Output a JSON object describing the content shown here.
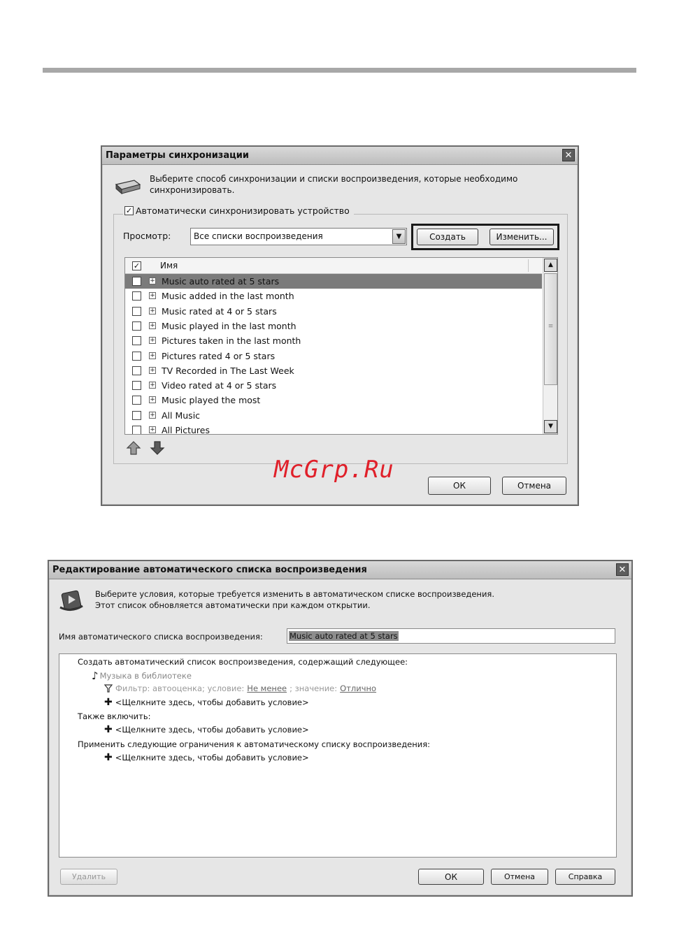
{
  "sync_dialog": {
    "title": "Параметры синхронизации",
    "description": "Выберите способ синхронизации и списки воспроизведения, которые необходимо синхронизировать.",
    "auto_sync_label": "Автоматически синхронизировать устройство",
    "auto_sync_checked": true,
    "view_label": "Просмотр:",
    "view_value": "Все списки воспроизведения",
    "create_button": "Создать",
    "edit_button": "Изменить...",
    "column_name": "Имя",
    "playlists": [
      {
        "label": "Music auto rated at 5 stars",
        "selected": true
      },
      {
        "label": "Music added in the last month"
      },
      {
        "label": "Music rated at 4 or 5 stars"
      },
      {
        "label": "Music played in the last month"
      },
      {
        "label": "Pictures taken in the last month"
      },
      {
        "label": "Pictures rated 4 or 5 stars"
      },
      {
        "label": "TV Recorded in The Last Week"
      },
      {
        "label": "Video rated at 4 or 5 stars"
      },
      {
        "label": "Music played the most"
      },
      {
        "label": "All Music"
      },
      {
        "label": "All Pictures"
      }
    ],
    "ok_button": "ОК",
    "cancel_button": "Отмена"
  },
  "watermark": "McGrp.Ru",
  "edit_dialog": {
    "title": "Редактирование автоматического списка воспроизведения",
    "description_line1": "Выберите условия, которые требуется изменить в автоматическом списке воспроизведения.",
    "description_line2": "Этот список обновляется автоматически при каждом открытии.",
    "name_label": "Имя автоматического списка воспроизведения:",
    "name_value": "Music auto rated at 5 stars",
    "rules": {
      "create_heading": "Создать автоматический список воспроизведения, содержащий следующее:",
      "library_item": "Музыка в библиотеке",
      "filter_prefix": "Фильтр: автооценка; условие:",
      "filter_condition": "Не менее",
      "filter_mid": "; значение:",
      "filter_value": "Отлично",
      "add_condition_1": "<Щелкните здесь, чтобы добавить условие>",
      "also_include": "Также включить:",
      "add_condition_2": "<Щелкните здесь, чтобы добавить условие>",
      "apply_limits": "Применить следующие ограничения к автоматическому списку воспроизведения:",
      "add_condition_3": "<Щелкните здесь, чтобы добавить условие>"
    },
    "delete_button": "Удалить",
    "ok_button": "ОК",
    "cancel_button": "Отмена",
    "help_button": "Справка"
  },
  "colors": {
    "selection": "#7b7b7b",
    "link": "#666666",
    "watermark": "#e0202a"
  }
}
